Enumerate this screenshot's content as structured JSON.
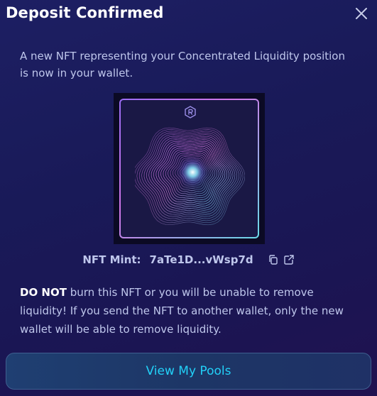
{
  "dialog": {
    "title": "Deposit Confirmed",
    "intro": "A new NFT representing your Concentrated Liquidity position is now in your wallet."
  },
  "nft": {
    "mint_label": "NFT Mint:",
    "mint_value": "7aTe1D...vWsp7d",
    "logo_icon": "raydium-logo-icon",
    "copy_icon": "copy-icon",
    "external_icon": "external-link-icon"
  },
  "warning": {
    "emphasis": "DO NOT",
    "text": " burn this NFT or you will be unable to remove liquidity! If you send the NFT to another wallet, only the new wallet will be able to remove liquidity."
  },
  "actions": {
    "view_pools_label": "View My Pools"
  },
  "colors": {
    "accent": "#22d1f8",
    "text": "#bfc7ec",
    "title": "#ffffff",
    "background": "#1b1b5c"
  }
}
